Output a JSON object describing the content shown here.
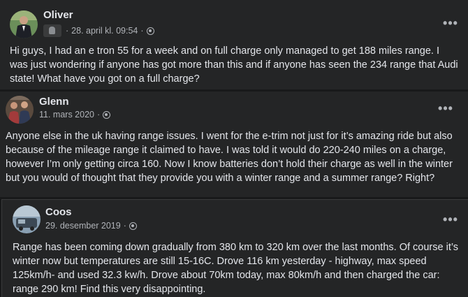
{
  "posts": [
    {
      "author": "Oliver",
      "date": "28. april kl. 09:54",
      "has_badge": true,
      "text": "Hi guys, I had an e tron 55 for a week and on full charge only managed to get 188 miles range. I was just wondering if anyone has got more than this and if anyone has seen the 234 range that Audi state! What have you got on a full charge?"
    },
    {
      "author": "Glenn",
      "date": "11. mars 2020",
      "text": "Anyone else in the uk having range issues. I went for the e-trim not just for it’s amazing ride but also because of the mileage range it claimed to have. I was told it would do 220-240 miles on a charge, however I’m only getting circa 160. Now I know batteries don’t hold their charge as well in the winter but you would of thought that they provide you with a winter range and a summer range? Right?"
    },
    {
      "author": "Coos",
      "date": "29. desember 2019",
      "text": "Range has been coming down gradually from 380 km to 320 km over the last months. Of course it’s winter now but temperatures are still 15-16C. Drove 116 km yesterday - highway, max speed 125km/h- and used 32.3 kw/h. Drove about 70km today, max 80km/h and then charged the car: range 290 km! Find this very disappointing."
    }
  ],
  "ui": {
    "more_label": "•••",
    "separator": "·"
  },
  "icons": {
    "audience": "globe-icon",
    "more": "more-options-icon",
    "badge": "waving-hand-icon"
  }
}
